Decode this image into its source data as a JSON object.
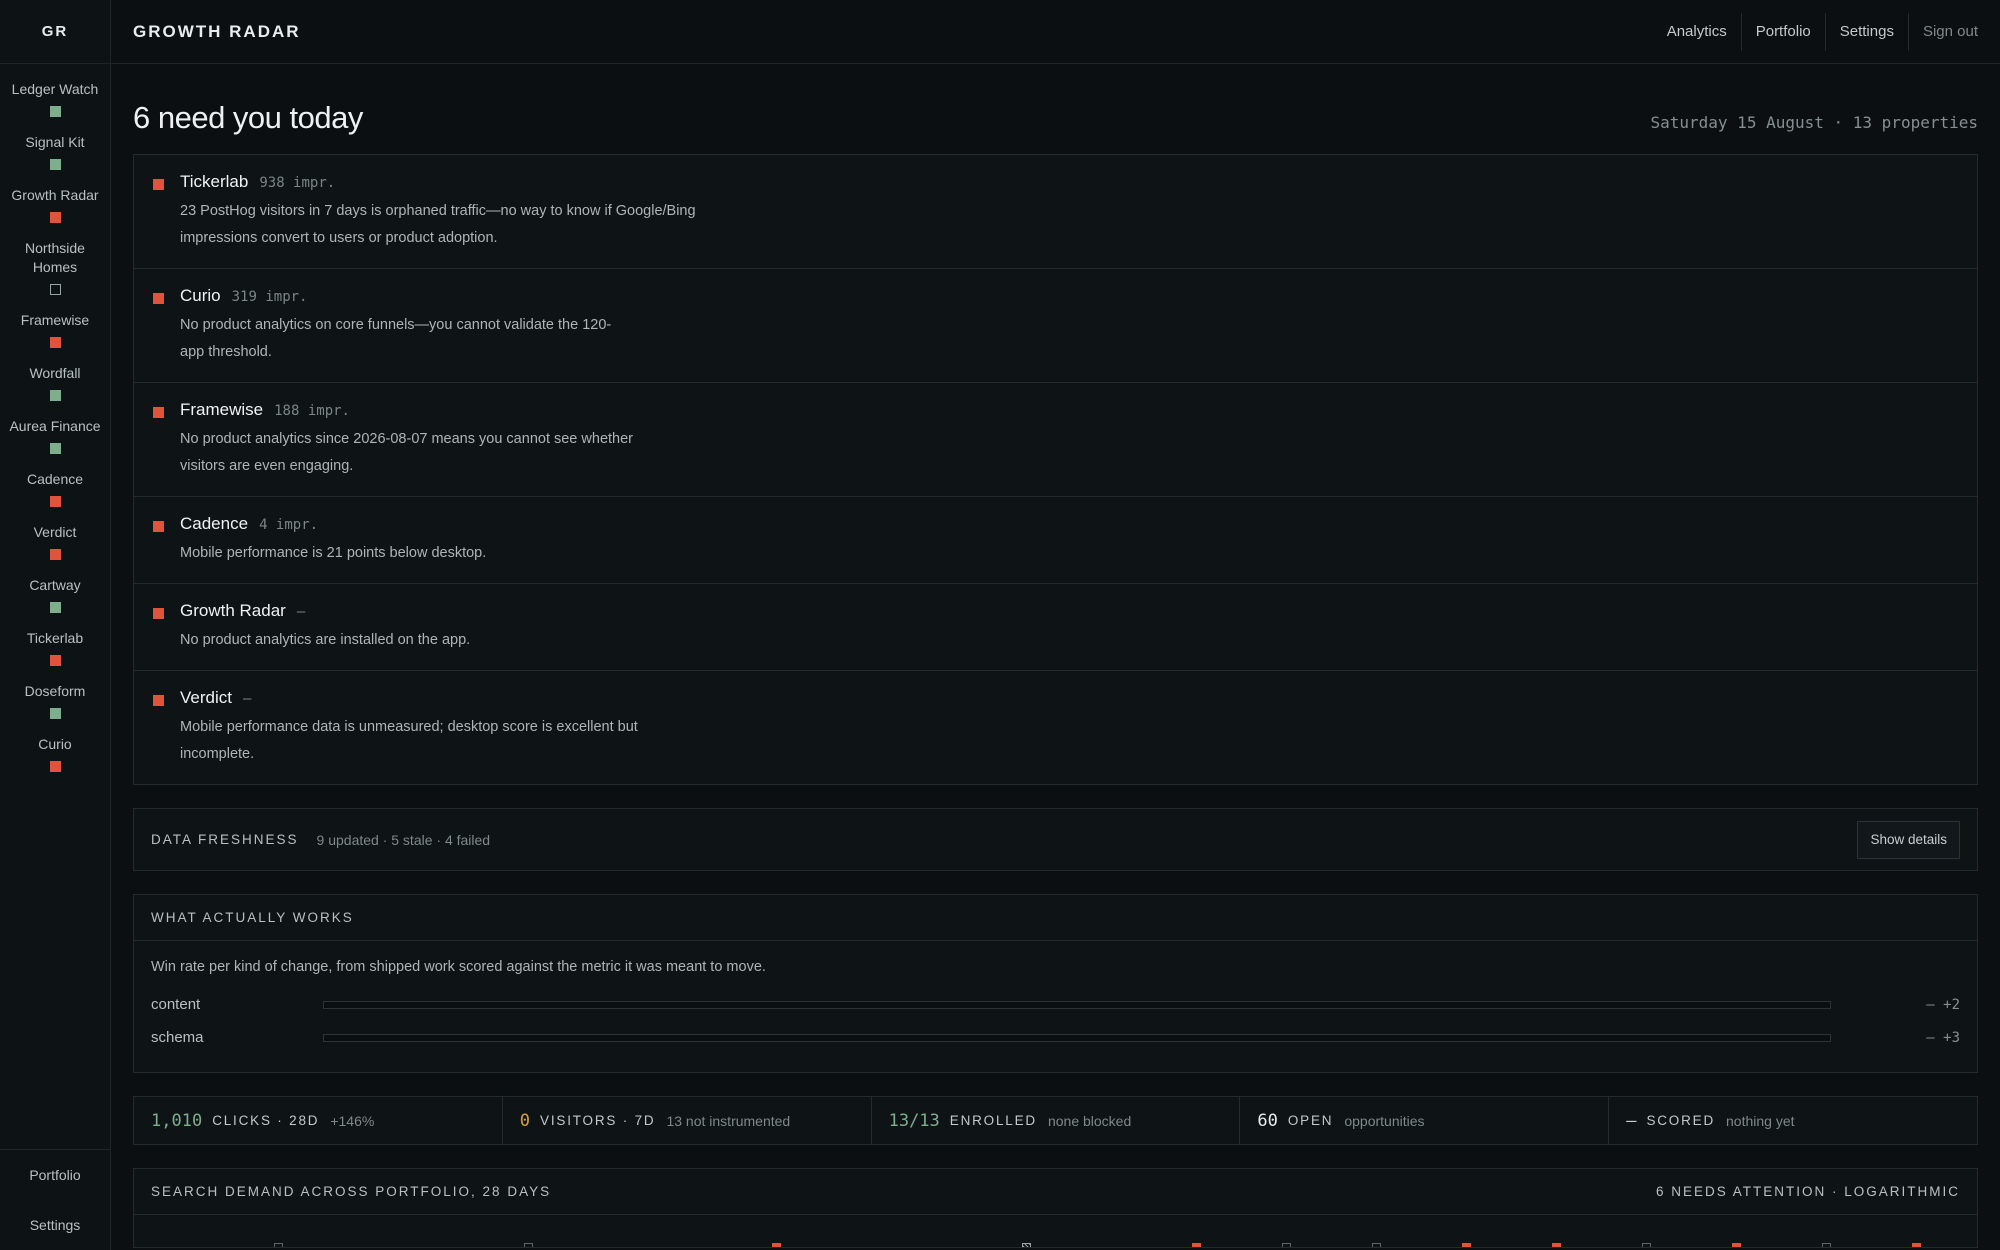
{
  "sidebar": {
    "logo": "GR",
    "items": [
      {
        "label": "Ledger Watch",
        "status": "green"
      },
      {
        "label": "Signal Kit",
        "status": "green"
      },
      {
        "label": "Growth Radar",
        "status": "red"
      },
      {
        "label": "Northside Homes",
        "status": "empty"
      },
      {
        "label": "Framewise",
        "status": "red"
      },
      {
        "label": "Wordfall",
        "status": "green"
      },
      {
        "label": "Aurea Finance",
        "status": "green"
      },
      {
        "label": "Cadence",
        "status": "red"
      },
      {
        "label": "Verdict",
        "status": "red"
      },
      {
        "label": "Cartway",
        "status": "green"
      },
      {
        "label": "Tickerlab",
        "status": "red"
      },
      {
        "label": "Doseform",
        "status": "green"
      },
      {
        "label": "Curio",
        "status": "red"
      }
    ],
    "bottom": [
      "Portfolio",
      "Settings"
    ]
  },
  "header": {
    "brand": "GROWTH RADAR",
    "nav": [
      "Analytics",
      "Portfolio",
      "Settings",
      "Sign out"
    ]
  },
  "main": {
    "title": "6 need you today",
    "date_line": "Saturday 15 August · 13 properties",
    "alerts": [
      {
        "name": "Tickerlab",
        "meta": "938 impr.",
        "text": "23 PostHog visitors in 7 days is orphaned traffic—no way to know if Google/Bing impressions convert to users or product adoption."
      },
      {
        "name": "Curio",
        "meta": "319 impr.",
        "text": "No product analytics on core funnels—you cannot validate the 120-app threshold."
      },
      {
        "name": "Framewise",
        "meta": "188 impr.",
        "text": "No product analytics since 2026-08-07 means you cannot see whether visitors are even engaging."
      },
      {
        "name": "Cadence",
        "meta": "4 impr.",
        "text": "Mobile performance is 21 points below desktop."
      },
      {
        "name": "Growth Radar",
        "meta": "—",
        "text": "No product analytics are installed on the app."
      },
      {
        "name": "Verdict",
        "meta": "—",
        "text": "Mobile performance data is unmeasured; desktop score is excellent but incomplete."
      }
    ],
    "freshness": {
      "label": "DATA FRESHNESS",
      "summary": "9 updated · 5 stale · 4 failed",
      "button": "Show details"
    },
    "works": {
      "label": "WHAT ACTUALLY WORKS",
      "description": "Win rate per kind of change, from shipped work scored against the metric it was meant to move.",
      "rows": [
        {
          "label": "content",
          "value": "— +2"
        },
        {
          "label": "schema",
          "value": "— +3"
        }
      ]
    },
    "stats": [
      {
        "value": "1,010",
        "label": "CLICKS · 28D",
        "sub": "+146%",
        "color": "#7fae8e"
      },
      {
        "value": "0",
        "label": "VISITORS · 7D",
        "sub": "13 not instrumented",
        "color": "#d9a13a"
      },
      {
        "value": "13/13",
        "label": "ENROLLED",
        "sub": "none blocked",
        "color": "#7fae8e"
      },
      {
        "value": "60",
        "label": "OPEN",
        "sub": "opportunities",
        "color": "#e8ecee"
      },
      {
        "value": "—",
        "label": "SCORED",
        "sub": "nothing yet",
        "color": "#c9ced1"
      }
    ],
    "demand": {
      "label": "SEARCH DEMAND ACROSS PORTFOLIO, 28 DAYS",
      "right": "6 NEEDS ATTENTION · LOGARITHMIC",
      "markers": [
        "empty",
        "empty",
        "red",
        "hatched",
        "red",
        "empty",
        "empty",
        "red",
        "red",
        "empty",
        "red",
        "empty",
        "red"
      ]
    }
  },
  "colors": {
    "green": "#7fae8e",
    "red": "#e0533d",
    "amber": "#d9a13a",
    "background": "#0b0f11"
  }
}
